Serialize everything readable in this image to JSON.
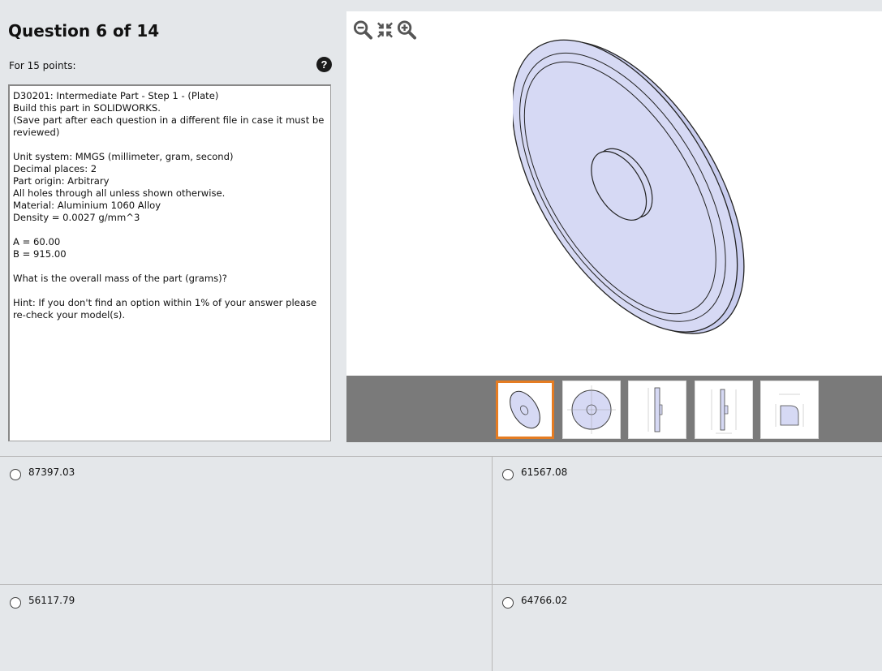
{
  "question": {
    "title": "Question 6 of 14",
    "points": "For 15 points:",
    "help_icon": "question-circle-icon",
    "text": "D30201:  Intermediate Part - Step 1 - (Plate)\nBuild this part in SOLIDWORKS.\n(Save part after each question in a different file in case it must be reviewed)\n\nUnit system: MMGS (millimeter, gram, second)\nDecimal places: 2\nPart origin: Arbitrary\nAll holes through all unless shown otherwise.\nMaterial: Aluminium 1060 Alloy\nDensity = 0.0027 g/mm^3\n\nA = 60.00\nB = 915.00\n\nWhat is the overall mass of the part (grams)?\n\nHint: If you don't find an option within 1% of your answer please re-check your model(s)."
  },
  "viewer": {
    "toolbar": [
      "zoom-out-icon",
      "fit-to-view-icon",
      "zoom-in-icon"
    ],
    "thumbnails": [
      {
        "icon": "isometric-view-thumbnail",
        "active": true
      },
      {
        "icon": "front-view-drawing-thumbnail",
        "active": false
      },
      {
        "icon": "side-view-drawing-thumbnail",
        "active": false
      },
      {
        "icon": "section-view-drawing-thumbnail",
        "active": false
      },
      {
        "icon": "detail-view-drawing-thumbnail",
        "active": false
      }
    ],
    "part_color": "#d6d9f4"
  },
  "options": [
    {
      "value": "87397.03"
    },
    {
      "value": "61567.08"
    },
    {
      "value": "56117.79"
    },
    {
      "value": "64766.02"
    }
  ]
}
